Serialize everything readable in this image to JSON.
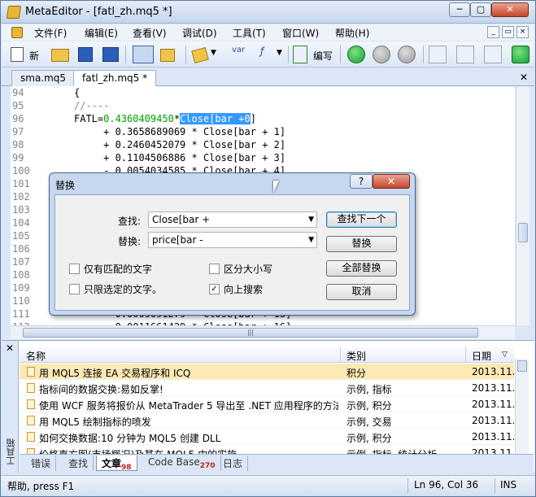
{
  "window": {
    "title": "MetaEditor - [fatl_zh.mq5 *]",
    "min": "─",
    "max": "▢",
    "close": "✕"
  },
  "menu": {
    "items": [
      "文件(F)",
      "编辑(E)",
      "查看(V)",
      "调试(D)",
      "工具(T)",
      "窗口(W)",
      "帮助(H)"
    ],
    "mdi_min": "_",
    "mdi_restore": "▭",
    "mdi_close": "×"
  },
  "toolbar": {
    "new_label": "新",
    "compile_label": "编写",
    "var_label": "var",
    "func_label": "ƒ"
  },
  "file_tabs": [
    "sma.mq5",
    "fatl_zh.mq5 *"
  ],
  "file_tab_close": "✕",
  "editor": {
    "lines": [
      {
        "num": "94",
        "code": "{"
      },
      {
        "num": "95",
        "code": "//----"
      },
      {
        "num": "96",
        "code": "FATL=0.4360409450*Close[bar +0]"
      },
      {
        "num": "97",
        "code": "     + 0.3658689069 * Close[bar + 1]"
      },
      {
        "num": "98",
        "code": "     + 0.2460452079 * Close[bar + 2]"
      },
      {
        "num": "99",
        "code": "     + 0.1104506886 * Close[bar + 3]"
      },
      {
        "num": "100",
        "code": "     - 0.0054034585 * Close[bar + 4]"
      },
      {
        "num": "101",
        "code": ""
      },
      {
        "num": "102",
        "code": ""
      },
      {
        "num": "103",
        "code": ""
      },
      {
        "num": "104",
        "code": ""
      },
      {
        "num": "105",
        "code": ""
      },
      {
        "num": "106",
        "code": ""
      },
      {
        "num": "107",
        "code": ""
      },
      {
        "num": "108",
        "code": ""
      },
      {
        "num": "109",
        "code": ""
      },
      {
        "num": "110",
        "code": ""
      },
      {
        "num": "111",
        "code": "     - 0.0009091279 * Close[bar + 15]"
      },
      {
        "num": "112",
        "code": "     - 0.0011661429 * Close[bar + 16]"
      }
    ],
    "line96": {
      "prefix": "FATL=",
      "number": "0.4360409450",
      "star": "*",
      "close": "Close",
      "bracket": "[bar +",
      "zero": "0",
      "end": "]"
    }
  },
  "dialog": {
    "title": "替换",
    "help": "?",
    "close": "✕",
    "find_label": "查找:",
    "find_value": "Close[bar +",
    "replace_label": "替换:",
    "replace_value": "price[bar -",
    "btn_find_next": "查找下一个",
    "btn_replace": "替换",
    "btn_replace_all": "全部替换",
    "btn_cancel": "取消",
    "opt_whole": "仅有匹配的文字",
    "opt_case": "区分大小写",
    "opt_selection": "只限选定的文字。",
    "opt_up": "向上搜索",
    "check_mark": "✓"
  },
  "toolbox": {
    "close": "✕",
    "side_label": "工具箱",
    "headers": {
      "name": "名称",
      "category": "类别",
      "date": "日期"
    },
    "rows": [
      {
        "name": "用 MQL5 连接 EA 交易程序和 ICQ",
        "category": "积分",
        "date": "2013.11..."
      },
      {
        "name": "指标间的数据交换:易如反掌!",
        "category": "示例, 指标",
        "date": "2013.11..."
      },
      {
        "name": "使用 WCF 服务将报价从 MetaTrader 5 导出至 .NET 应用程序的方法",
        "category": "示例, 积分",
        "date": "2013.11..."
      },
      {
        "name": "用 MQL5 绘制指标的喷发",
        "category": "示例, 交易",
        "date": "2013.11..."
      },
      {
        "name": "如何交换数据:10 分钟为 MQL5 创建 DLL",
        "category": "示例, 积分",
        "date": "2013.11..."
      },
      {
        "name": "价格直方图(市场概况)及其在 MQL5 中的实施",
        "category": "示例, 指标, 统计分析",
        "date": "2013.11..."
      }
    ],
    "tabs": [
      {
        "label": "错误",
        "count": ""
      },
      {
        "label": "查找",
        "count": ""
      },
      {
        "label": "文章",
        "count": "98"
      },
      {
        "label": "Code Base",
        "count": "270"
      },
      {
        "label": "日志",
        "count": ""
      }
    ]
  },
  "status": {
    "help": "帮助, press F1",
    "position": "Ln 96, Col 36",
    "mode": "INS"
  },
  "colors": {
    "keyword": "#e4008a",
    "number": "#00a000",
    "comment": "#888888",
    "selection": "#3399ff"
  }
}
